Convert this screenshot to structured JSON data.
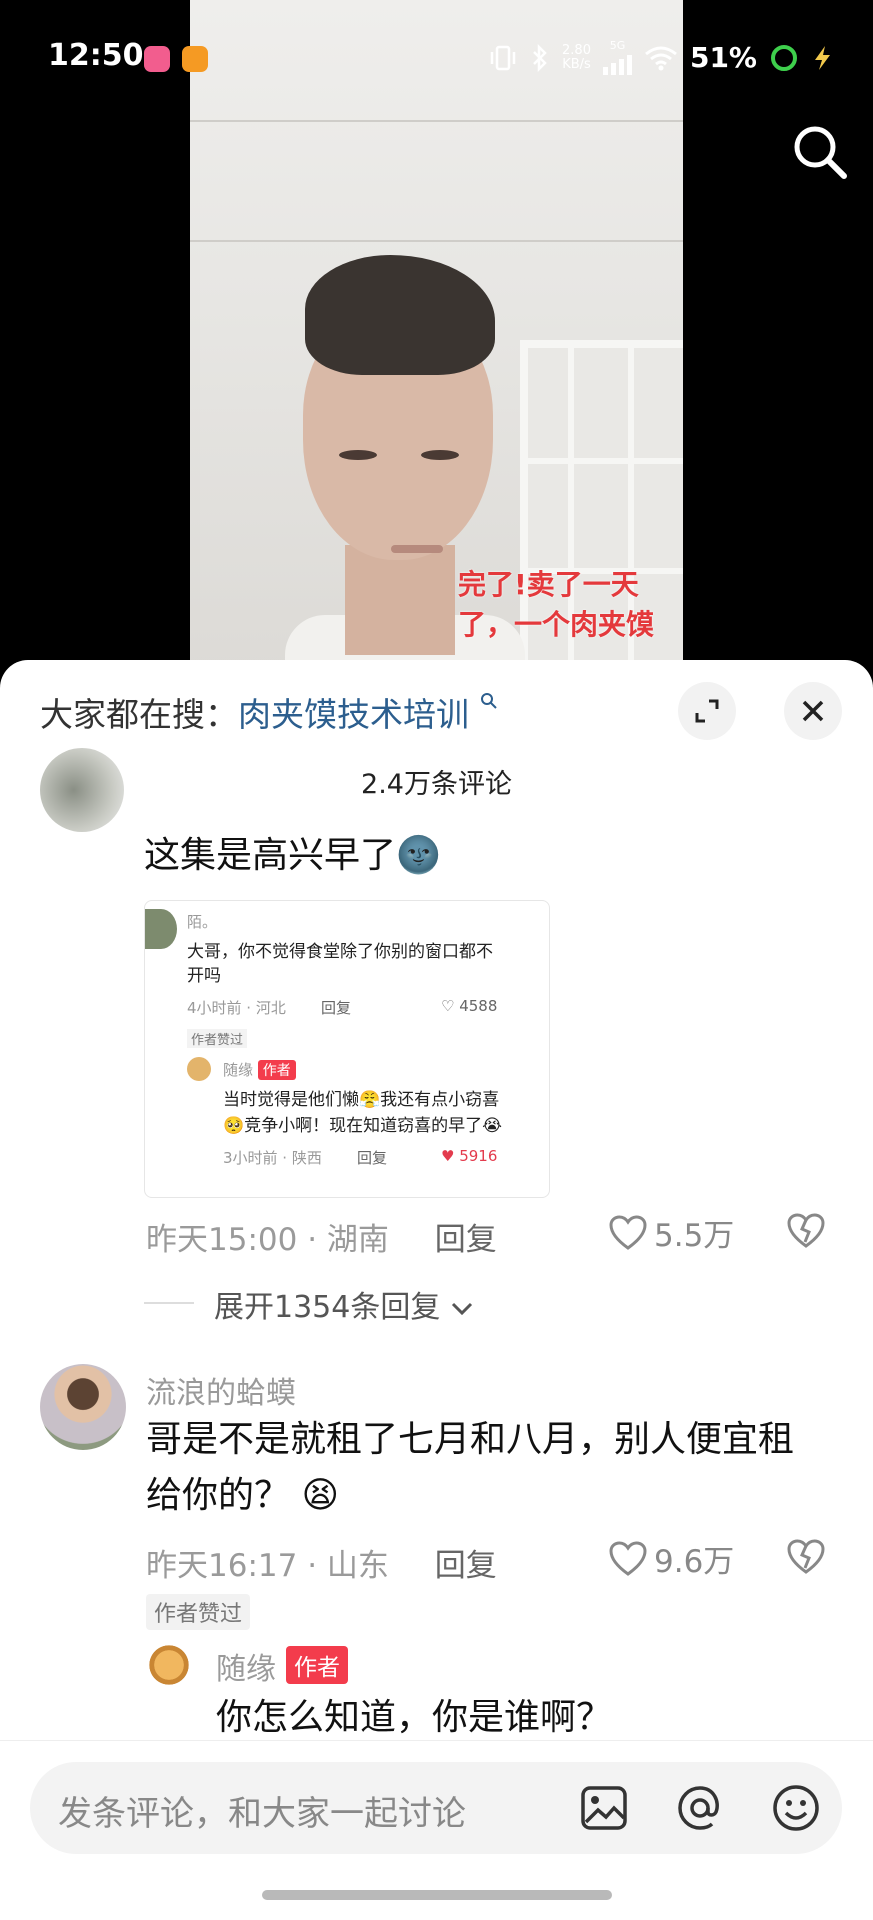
{
  "status_bar": {
    "time": "12:50",
    "net_speed_value": "2.80",
    "net_speed_unit": "KB/s",
    "network": "5G",
    "battery": "51%"
  },
  "video": {
    "caption_line1": "完了!卖了一天",
    "caption_line2": "了，一个肉夹馍"
  },
  "comments_header": {
    "hot_search_prefix": "大家都在搜：",
    "hot_search_keyword": "肉夹馍技术培训",
    "count_label": "2.4万条评论"
  },
  "comments": [
    {
      "text": "这集是高兴早了",
      "emoji": "🌚",
      "embedded": {
        "user": "陌。",
        "text_line1": "大哥，你不觉得食堂除了你别的窗口都不",
        "text_line2": "开吗",
        "meta": "4小时前 · 河北",
        "reply": "回复",
        "likes": "4588",
        "liked_badge": "作者赞过",
        "reply_user": "随缘",
        "reply_tag": "作者",
        "reply_line1": "当时觉得是他们懒😤我还有点小窃喜",
        "reply_line2": "🥺竞争小啊！现在知道窃喜的早了😭",
        "reply_meta": "3小时前 · 陕西",
        "reply_reply": "回复",
        "reply_likes": "5916"
      },
      "meta": "昨天15:00 · 湖南",
      "reply": "回复",
      "likes": "5.5万",
      "expand": "展开1354条回复"
    },
    {
      "user": "流浪的蛤蟆",
      "text_line1": "哥是不是就租了七月和八月，别人便宜租",
      "text_line2": "给你的？",
      "emoji": "😫",
      "meta": "昨天16:17 · 山东",
      "reply": "回复",
      "likes": "9.6万",
      "liked_badge": "作者赞过",
      "reply_user": "随缘",
      "reply_tag": "作者",
      "reply_text": "你怎么知道，你是谁啊？"
    }
  ],
  "input": {
    "placeholder": "发条评论，和大家一起讨论"
  },
  "colors": {
    "accent_red": "#f33c4c",
    "keyword_blue": "#2c5e8e",
    "caption_red": "#e4393c"
  }
}
